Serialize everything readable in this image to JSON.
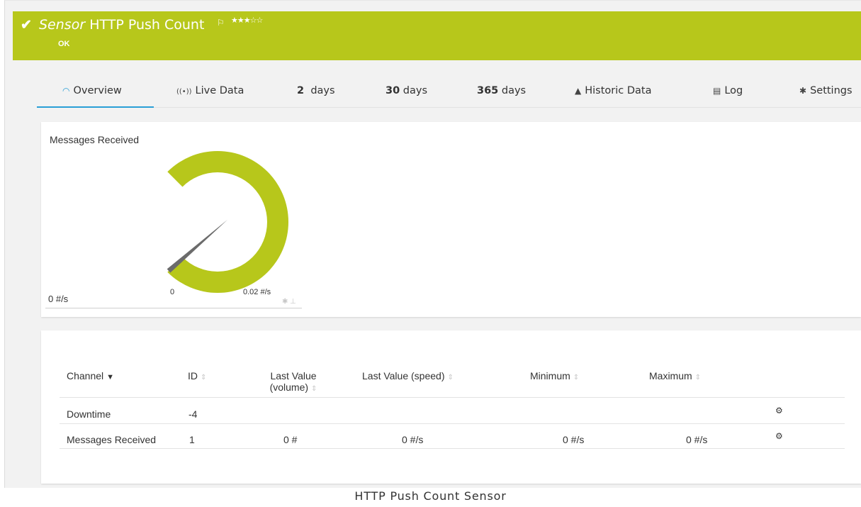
{
  "header": {
    "check_icon": "checkmark-icon",
    "title_prefix": "Sensor",
    "title": "HTTP Push Count",
    "flag_icon": "flag-icon",
    "stars": "★★★☆☆",
    "status": "OK",
    "color": "#b7c71b"
  },
  "tabs": [
    {
      "icon": "gauge-icon",
      "label": "Overview"
    },
    {
      "icon": "live-signal-icon",
      "label": "Live Data"
    },
    {
      "number": "2",
      "label": "days"
    },
    {
      "number": "30",
      "label": "days"
    },
    {
      "number": "365",
      "label": "days"
    },
    {
      "icon": "area-chart-icon",
      "label": "Historic Data"
    },
    {
      "icon": "log-list-icon",
      "label": "Log"
    },
    {
      "icon": "gear-icon",
      "label": "Settings"
    }
  ],
  "gauge": {
    "title": "Messages Received",
    "min_label": "0",
    "max_label": "0.02 #/s",
    "value_label": "0 #/s",
    "level": 0,
    "color": "#b7c71b"
  },
  "table": {
    "headers": {
      "channel": "Channel",
      "id": "ID",
      "last_value_volume_line1": "Last Value",
      "last_value_volume_line2": "(volume)",
      "last_value_speed": "Last Value (speed)",
      "minimum": "Minimum",
      "maximum": "Maximum"
    },
    "rows": [
      {
        "channel": "Downtime",
        "id": "-4",
        "volume": "",
        "speed": "",
        "minimum": "",
        "maximum": ""
      },
      {
        "channel": "Messages Received",
        "id": "1",
        "volume": "0 #",
        "speed": "0 #/s",
        "minimum": "0 #/s",
        "maximum": "0 #/s"
      }
    ]
  },
  "caption": "HTTP Push Count Sensor"
}
